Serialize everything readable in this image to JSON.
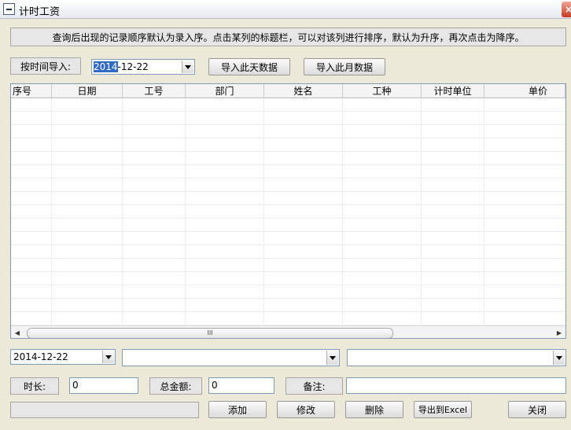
{
  "window": {
    "title": "计时工资",
    "close_glyph": "×"
  },
  "info_text": "查询后出现的记录顺序默认为录入序。点击某列的标题栏，可以对该列进行排序，默认为升序，再次点击为降序。",
  "import_bar": {
    "label": "按时间导入:",
    "date_value": "2014-12-22",
    "import_day_button": "导入此天数据",
    "import_month_button": "导入此月数据"
  },
  "grid": {
    "columns": [
      "序号",
      "日期",
      "工号",
      "部门",
      "姓名",
      "工种",
      "计时单位",
      "单价"
    ],
    "rows": [],
    "scroll_grip": "III",
    "scroll_left": "◀",
    "scroll_right": "▶"
  },
  "filters": {
    "date_value": "2014-12-22",
    "combo2_value": "",
    "combo3_value": ""
  },
  "fields": {
    "duration_label": "时长:",
    "duration_value": "0",
    "total_label": "总金额:",
    "total_value": "0",
    "note_label": "备注:",
    "note_value": ""
  },
  "actions": {
    "status_text": "",
    "add": "添加",
    "edit": "修改",
    "delete": "删除",
    "export": "导出到Excel",
    "close": "关闭"
  }
}
